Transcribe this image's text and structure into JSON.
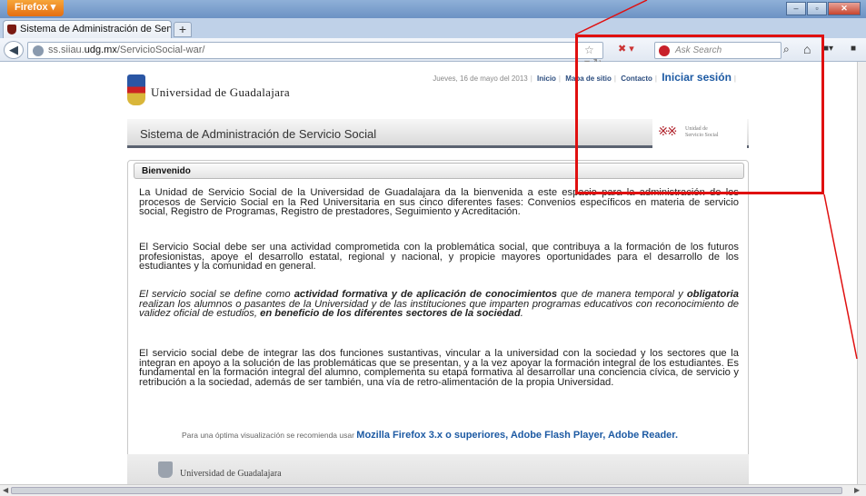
{
  "browser": {
    "menu_label": "Firefox",
    "tab_title": "Sistema de Administración de Servicio S...",
    "new_tab": "+",
    "url_prefix": "ss.siiau.",
    "url_host": "udg.mx",
    "url_path": "/ServicioSocial-war/",
    "search_placeholder": "Ask Search"
  },
  "header": {
    "date": "Jueves, 16 de mayo del 2013",
    "nav": [
      "Inicio",
      "Mapa de sitio",
      "Contacto"
    ],
    "login": "Iniciar sesión",
    "university": "Universidad de Guadalajara"
  },
  "banner": {
    "title": "Sistema de Administración de Servicio Social",
    "logo_text_1": "Unidad de",
    "logo_text_2": "Servicio Social"
  },
  "welcome": {
    "heading": "Bienvenido",
    "p1": "La Unidad de Servicio Social de la Universidad de Guadalajara da la bienvenida a este espacio para la administración de los procesos de Servicio Social en la Red Universitaria en sus cinco diferentes fases: Convenios específicos en materia de servicio social, Registro de Programas, Registro de prestadores, Seguimiento y Acreditación.",
    "p2": "El Servicio Social debe ser una actividad comprometida con la problemática social, que contribuya a la formación de los futuros profesionistas, apoye el desarrollo estatal, regional y nacional, y propicie mayores oportunidades para el desarrollo de los estudiantes y la comunidad en general.",
    "p3_a": "El servicio social se define como ",
    "p3_b": "actividad formativa y de aplicación de conocimientos",
    "p3_c": " que de manera temporal y ",
    "p3_d": "obligatoria",
    "p3_e": " realizan los alumnos o pasantes de la Universidad y de las instituciones que imparten programas educativos con reconocimiento de validez oficial de estudios, ",
    "p3_f": "en beneficio de los diferentes sectores de la sociedad",
    "p3_g": ".",
    "p4": "El servicio social debe de integrar las dos funciones sustantivas, vincular a la universidad con la sociedad y los sectores que la integran en apoyo a la solución de las problemáticas que se presentan, y a la vez apoyar la formación integral de los estudiantes. Es fundamental en la formación integral del alumno, complementa su etapa formativa al desarrollar una conciencia cívica, de servicio y retribución a la sociedad, además de ser también, una vía de retro-alimentación de la propia Universidad."
  },
  "footer": {
    "note": "Para una óptima visualización se recomienda usar ",
    "links": "Mozilla Firefox 3.x o superiores, Adobe Flash Player, Adobe Reader.",
    "university": "Universidad de Guadalajara"
  },
  "colors": {
    "annotation": "#e01010",
    "link": "#1d5aa3"
  }
}
